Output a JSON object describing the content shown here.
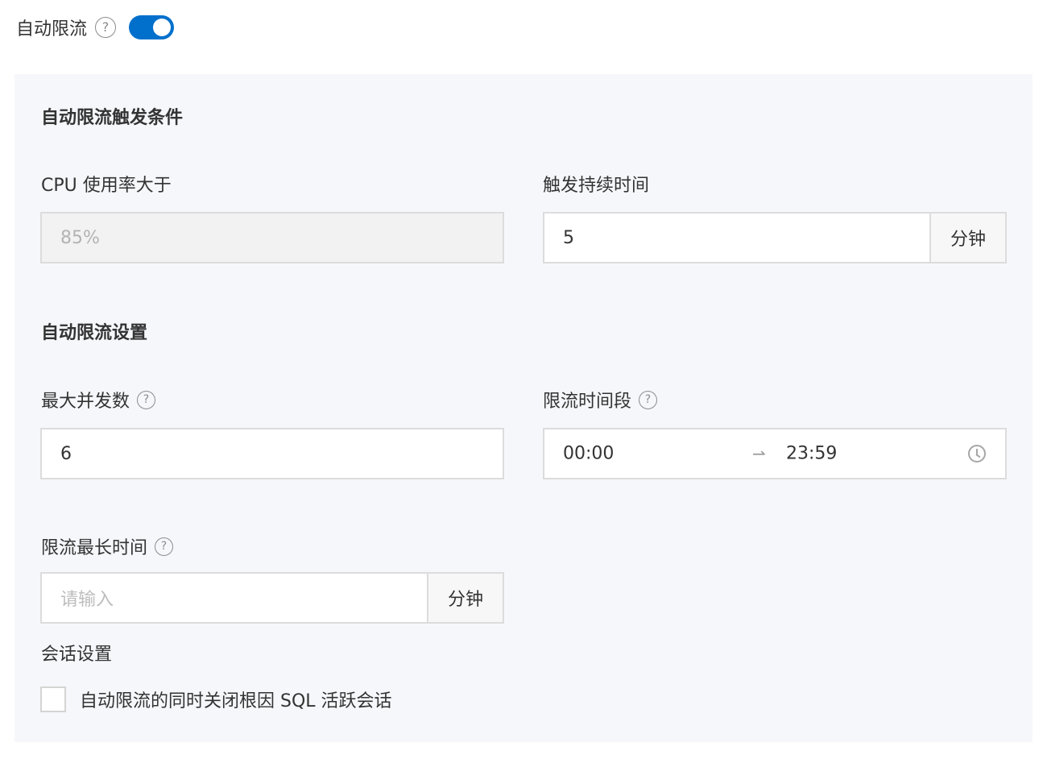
{
  "header": {
    "label": "自动限流",
    "help_icon": "question-circle-icon",
    "switch_on": true,
    "switch_color": "#0070cc"
  },
  "trigger_section": {
    "title": "自动限流触发条件",
    "cpu_label": "CPU 使用率大于",
    "cpu_value": "85%",
    "duration_label": "触发持续时间",
    "duration_value": "5",
    "duration_unit": "分钟"
  },
  "settings_section": {
    "title": "自动限流设置",
    "max_concurrency_label": "最大并发数",
    "max_concurrency_value": "6",
    "time_range_label": "限流时间段",
    "time_range_start": "00:00",
    "time_range_end": "23:59",
    "time_range_arrow": "⇀",
    "clock_icon": "clock-icon",
    "max_duration_label": "限流最长时间",
    "max_duration_placeholder": "请输入",
    "max_duration_unit": "分钟"
  },
  "session_section": {
    "title": "会话设置",
    "checkbox_label": "自动限流的同时关闭根因 SQL 活跃会话",
    "checkbox_checked": false
  }
}
